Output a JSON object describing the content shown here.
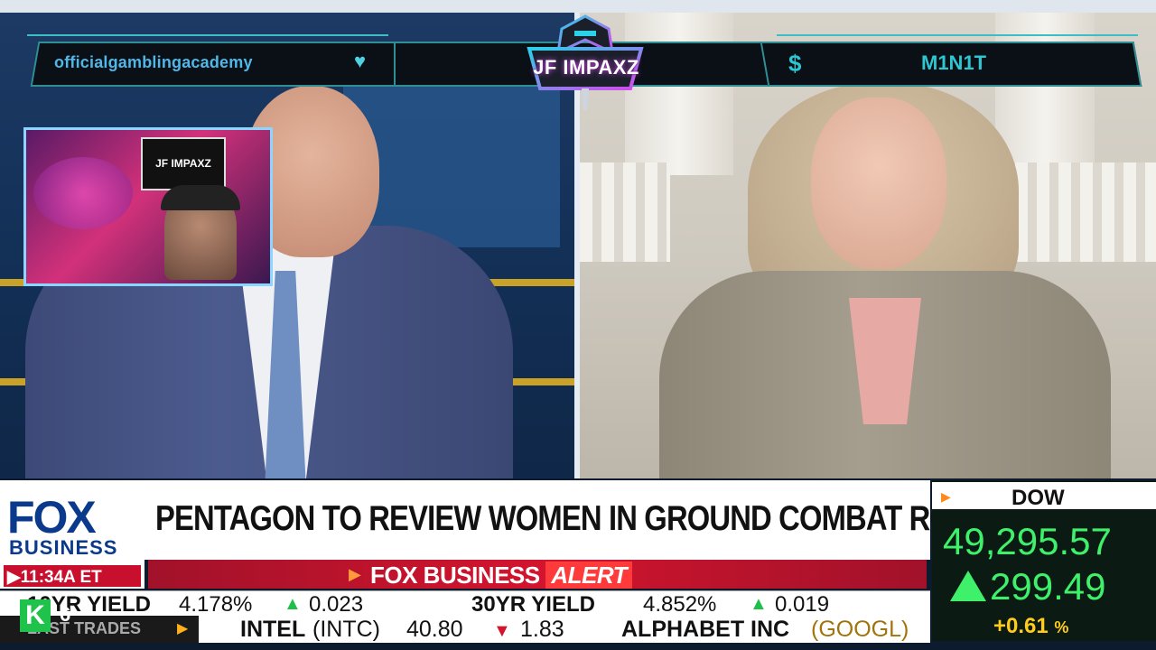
{
  "overlay": {
    "social_handle": "officialgamblingacademy",
    "heart_icon": "♥",
    "currency_icon": "$",
    "username": "M1N1T",
    "logo_text": "JF IMPAXZ"
  },
  "webcam": {
    "logo_text": "JF IMPAXZ"
  },
  "lower_third": {
    "network_fox": "FOX",
    "network_business": "BUSINESS",
    "time": "▶11:34A ET",
    "headline": "PENTAGON TO REVIEW WOMEN IN GROUND COMBAT ROLES",
    "alert_brand": "FOX BUSINESS",
    "alert_word": "ALERT"
  },
  "market": {
    "index_label": "DOW",
    "index_value": "49,295.57",
    "index_change": "299.49",
    "index_pct": "+0.61",
    "pct_sign": "%"
  },
  "ticker_top": {
    "item1_label": "10YR YIELD",
    "item1_value": "4.178%",
    "item1_change": "0.023",
    "item2_label": "30YR YIELD",
    "item2_value": "4.852%",
    "item2_change": "0.019"
  },
  "ticker_bottom": {
    "section_label": "LAST TRADES",
    "stock1_name": "INTEL",
    "stock1_symbol": "(INTC)",
    "stock1_price": "40.80",
    "stock1_change": "1.83",
    "stock2_name": "ALPHABET INC",
    "stock2_symbol": "(GOOGL)"
  },
  "badge": {
    "letter": "K",
    "number": "6"
  },
  "colors": {
    "fox_blue": "#0b3a8c",
    "alert_red": "#d3142e",
    "up_green": "#3ef06a",
    "overlay_teal": "#2ec6d0"
  }
}
